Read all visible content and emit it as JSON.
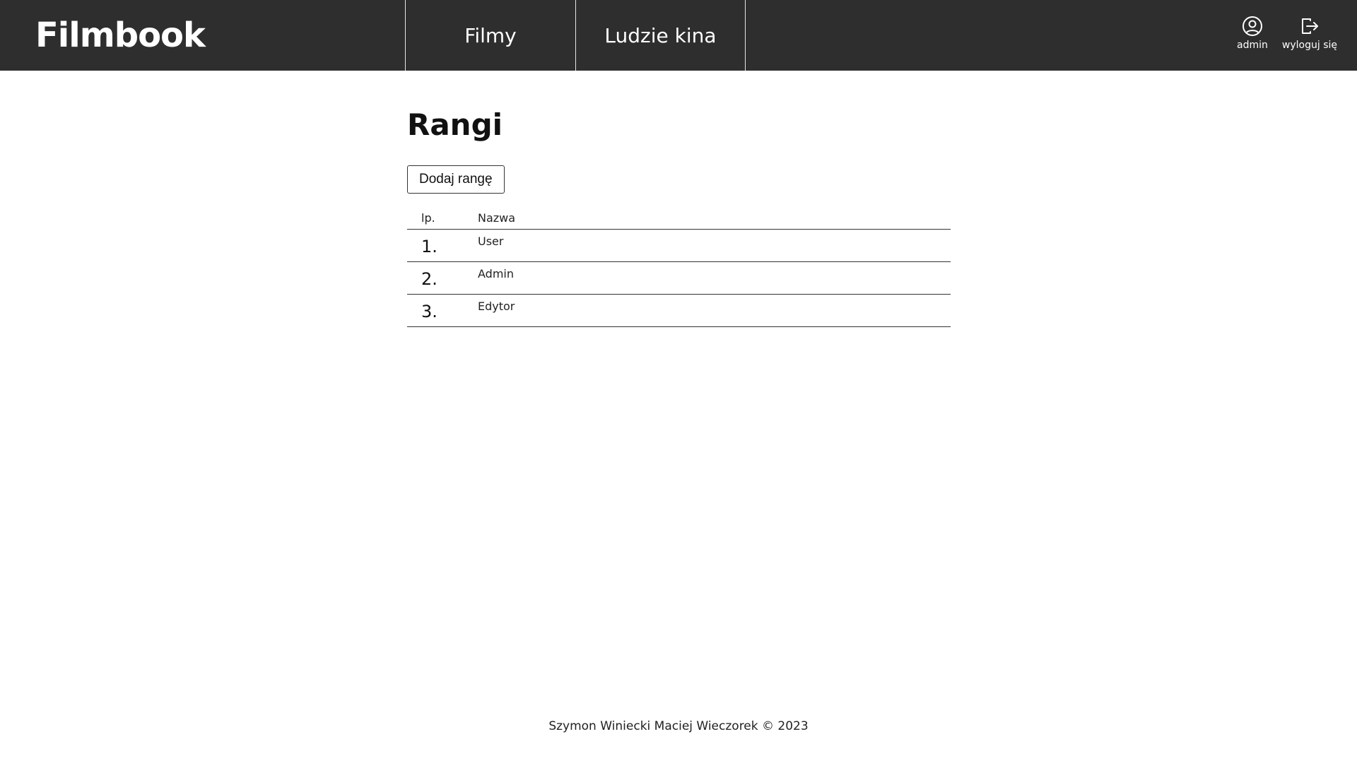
{
  "header": {
    "logo": "Filmbook",
    "nav": [
      {
        "label": "Filmy"
      },
      {
        "label": "Ludzie kina"
      }
    ],
    "user": {
      "account_label": "admin",
      "logout_label": "wyloguj się"
    }
  },
  "main": {
    "title": "Rangi",
    "add_button_label": "Dodaj rangę",
    "table": {
      "columns": [
        "lp.",
        "Nazwa"
      ],
      "rows": [
        {
          "num": "1.",
          "name": "User"
        },
        {
          "num": "2.",
          "name": "Admin"
        },
        {
          "num": "3.",
          "name": "Edytor"
        }
      ]
    }
  },
  "footer": {
    "text": "Szymon Winiecki Maciej Wieczorek © 2023"
  },
  "colors": {
    "navbar_bg": "#2e2e2e",
    "text": "#111111",
    "background": "#ffffff"
  },
  "icons": {
    "account": "user-circle-icon",
    "logout": "logout-icon"
  }
}
